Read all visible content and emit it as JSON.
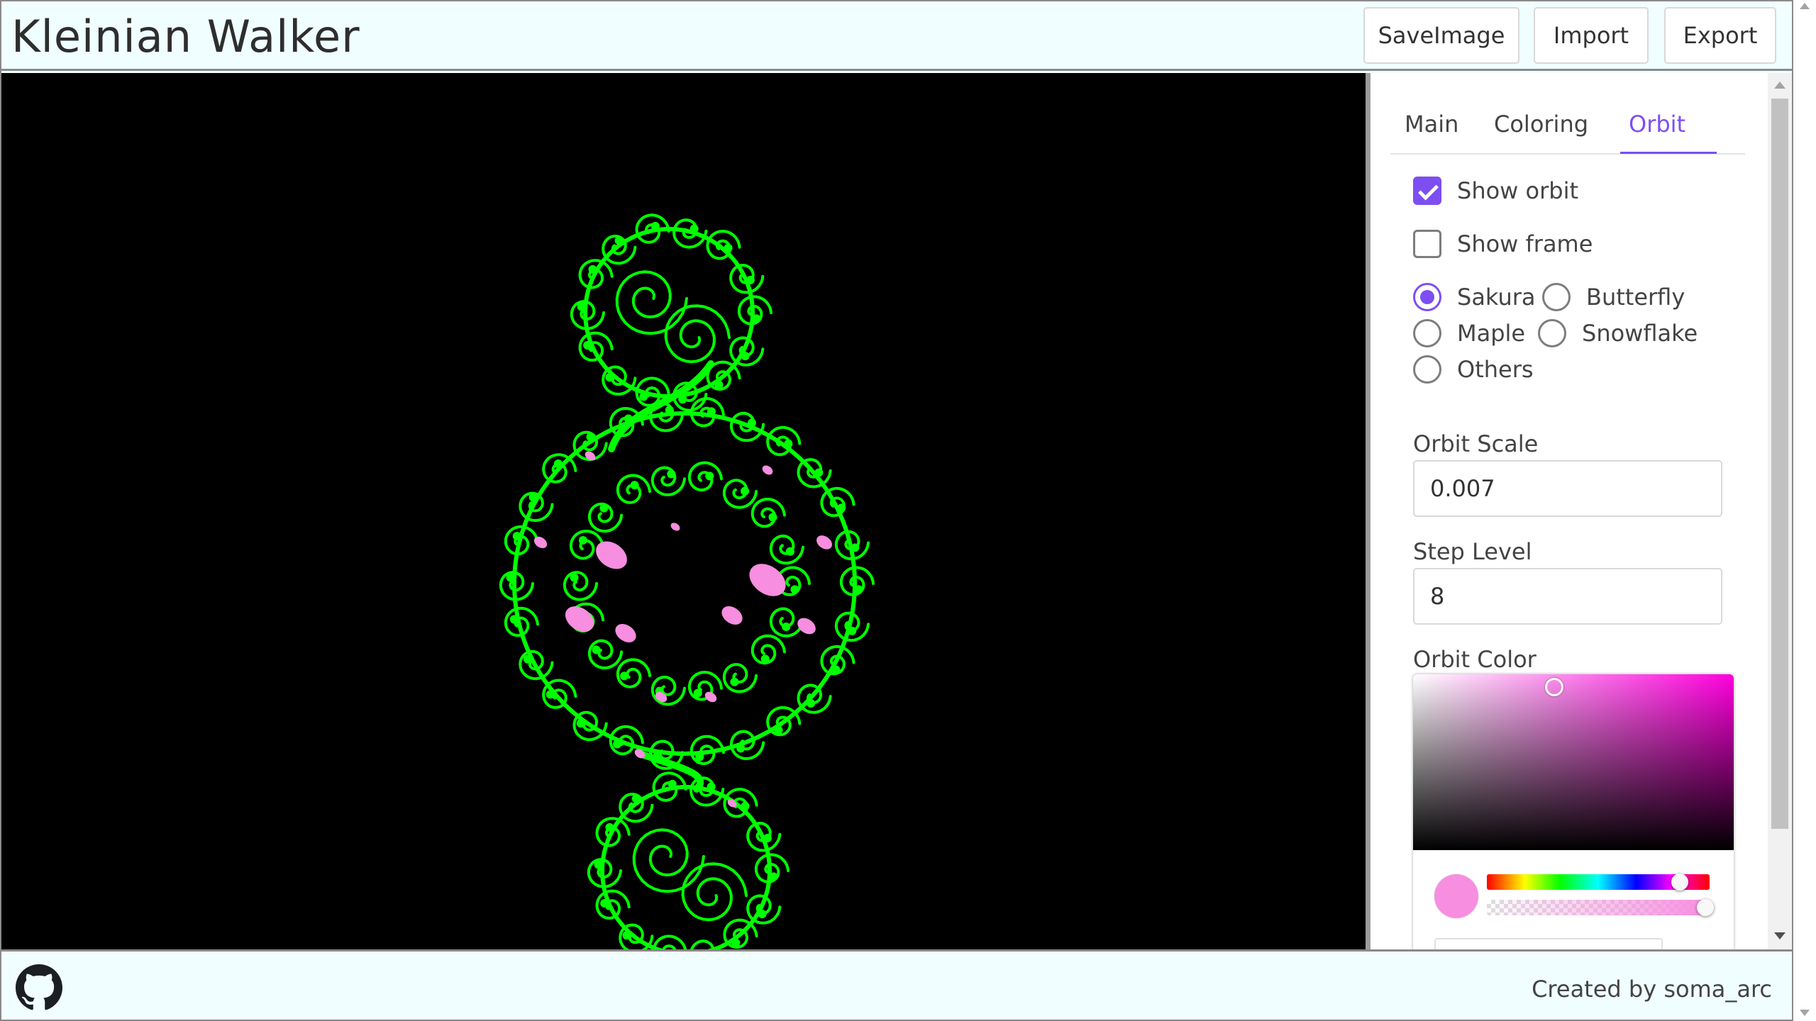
{
  "app": {
    "title": "Kleinian Walker"
  },
  "header": {
    "buttons": {
      "save": "SaveImage",
      "import": "Import",
      "export": "Export"
    }
  },
  "panel": {
    "tabs": {
      "main": "Main",
      "coloring": "Coloring",
      "orbit": "Orbit",
      "active": "Orbit"
    },
    "show_orbit": {
      "label": "Show orbit",
      "checked": true
    },
    "show_frame": {
      "label": "Show frame",
      "checked": false
    },
    "orbit_shape": {
      "options": [
        "Sakura",
        "Butterfly",
        "Maple",
        "Snowflake",
        "Others"
      ],
      "selected": "Sakura"
    },
    "orbit_scale": {
      "label": "Orbit Scale",
      "value": "0.007"
    },
    "step_level": {
      "label": "Step Level",
      "value": "8"
    },
    "orbit_color": {
      "label": "Orbit Color",
      "color": "#f78ee0",
      "hue_color": "#ff00dd"
    }
  },
  "canvas": {
    "fractal_color": "#00ff00",
    "orbit_color": "#f78ee0",
    "background": "#000000"
  },
  "footer": {
    "credit": "Created by soma_arc"
  },
  "icons": {
    "github": "github-icon"
  }
}
